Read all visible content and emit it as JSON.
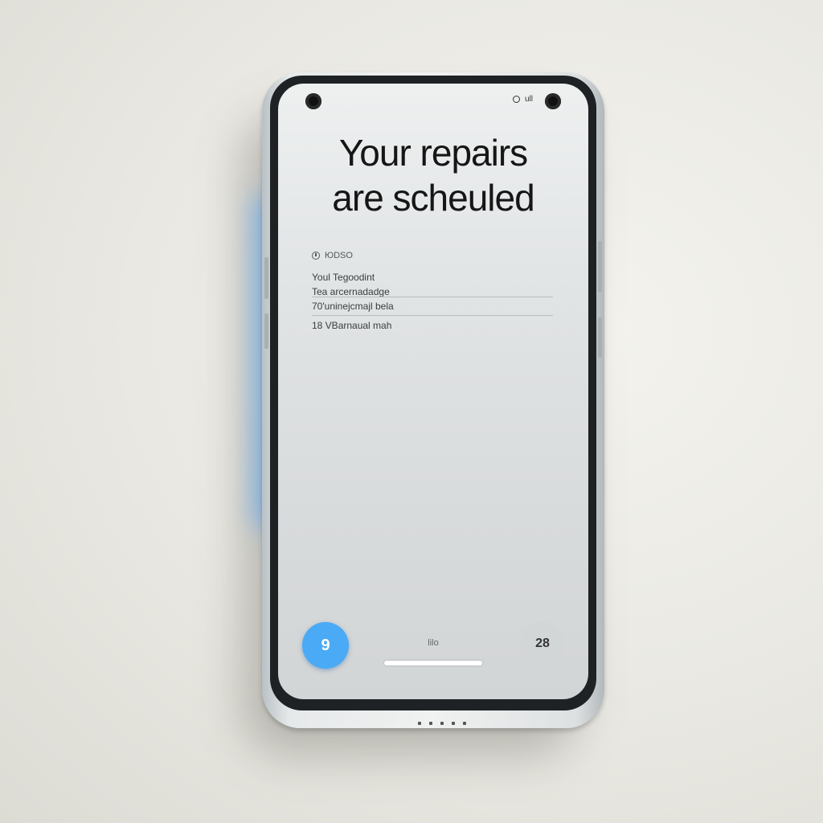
{
  "device": {
    "accent_color": "#4aaaf6",
    "screen_background": "#e2e5e6"
  },
  "status_bar": {
    "text": "ull",
    "icons": [
      "front-camera-icon",
      "status-ring-icon"
    ]
  },
  "main": {
    "headline_line1": "Your repairs",
    "headline_line2": "are scheuled",
    "details": {
      "header": "ЮDSO",
      "lines": [
        "Youl Tegoodint",
        "Tea arcernadadge",
        "70'uninejcmajl bela",
        "18 VBarnaual mah"
      ]
    }
  },
  "bottom_bar": {
    "left_button_label": "9",
    "center_label": "lilo",
    "right_button_label": "28"
  }
}
